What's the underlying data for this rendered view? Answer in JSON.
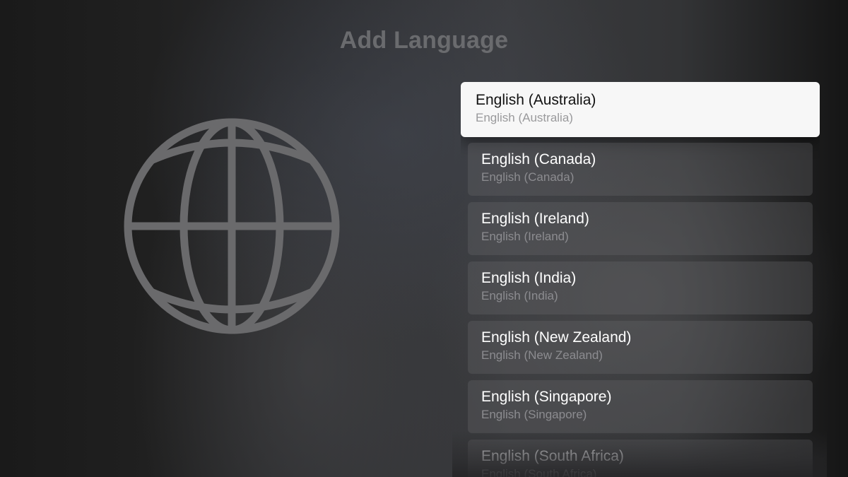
{
  "header": {
    "title": "Add Language"
  },
  "colors": {
    "focused_background": "#f7f7f7",
    "item_background": "#4a4a4c",
    "globe_stroke": "#6a6a6c"
  },
  "icons": {
    "hero": "globe-icon"
  },
  "languages": {
    "focused_index": 0,
    "items": [
      {
        "name": "English (Australia)",
        "native": "English (Australia)"
      },
      {
        "name": "English (Canada)",
        "native": "English (Canada)"
      },
      {
        "name": "English (Ireland)",
        "native": "English (Ireland)"
      },
      {
        "name": "English (India)",
        "native": "English (India)"
      },
      {
        "name": "English (New Zealand)",
        "native": "English (New Zealand)"
      },
      {
        "name": "English (Singapore)",
        "native": "English (Singapore)"
      },
      {
        "name": "English (South Africa)",
        "native": "English (South Africa)"
      }
    ]
  }
}
